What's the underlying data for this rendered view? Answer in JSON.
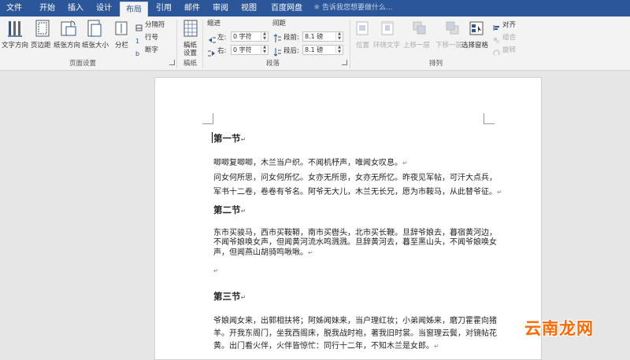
{
  "tabs": [
    "文件",
    "开始",
    "插入",
    "设计",
    "布局",
    "引用",
    "邮件",
    "审阅",
    "视图",
    "百度网盘"
  ],
  "active_tab": "布局",
  "tell_me": "告诉我您想要做什么...",
  "page_setup": {
    "text_direction": "文字方向",
    "margins": "页边距",
    "orientation": "纸张方向",
    "size": "纸张大小",
    "columns": "分栏",
    "breaks": "分隔符",
    "line_numbers": "行号",
    "hyphenation": "断字",
    "group_label": "页面设置"
  },
  "manuscript": {
    "label1": "稿纸",
    "label2": "设置",
    "group_label": "稿纸"
  },
  "paragraph": {
    "indent_title": "缩进",
    "spacing_title": "间距",
    "left_label": "左:",
    "left_value": "0 字符",
    "right_label": "右:",
    "right_value": "0 字符",
    "before_label": "段前:",
    "before_value": "8.1 磅",
    "after_label": "段后:",
    "after_value": "8.1 磅",
    "group_label": "段落"
  },
  "arrange": {
    "position": "位置",
    "wrap": "环绕文字",
    "forward": "上移一层",
    "backward": "下移一层",
    "selection": "选择窗格",
    "align": "对齐",
    "group": "组合",
    "rotate": "旋转",
    "group_label": "排列"
  },
  "document": {
    "lines": [
      {
        "text": "第一节",
        "type": "heading"
      },
      {
        "text": "唧唧复唧唧，木兰当户织。不闻机杼声，唯闻女叹息。",
        "type": "body"
      },
      {
        "text": "问女何所思，问女何所忆。女亦无所思，女亦无所忆。昨夜见军帖，可汗大点兵，",
        "type": "body"
      },
      {
        "text": "军书十二卷，卷卷有爷名。阿爷无大儿，木兰无长兄，愿为市鞍马，从此替爷征。",
        "type": "body"
      },
      {
        "text": "第二节",
        "type": "heading"
      },
      {
        "text": "东市买骏马，西市买鞍鞯，南市买辔头，北市买长鞭。旦辞爷娘去，暮宿黄河边，",
        "type": "body"
      },
      {
        "text": "不闻爷娘唤女声，但闻黄河流水鸣溅溅。旦辞黄河去，暮至黑山头，不闻爷娘唤女",
        "type": "body"
      },
      {
        "text": "声，但闻燕山胡骑鸣啾啾。",
        "type": "body"
      },
      {
        "text": "",
        "type": "empty"
      },
      {
        "text": "第三节",
        "type": "heading"
      },
      {
        "text": "爷娘闻女来，出郭相扶将；阿姊闻妹来，当户理红妆；小弟闻姊来，磨刀霍霍向猪",
        "type": "body"
      },
      {
        "text": "羊。开我东阁门，坐我西阁床，脱我战时袍，著我旧时裳。当窗理云鬓，对镜帖花",
        "type": "body"
      },
      {
        "text": "黄。出门看火伴，火伴皆惊忙：同行十二年，不知木兰是女郎。",
        "type": "body"
      }
    ]
  },
  "watermark": "云南龙网",
  "colors": {
    "tabbar": "#2b579a",
    "ribbon": "#f3f3f3",
    "watermark": "#ff6a00"
  }
}
